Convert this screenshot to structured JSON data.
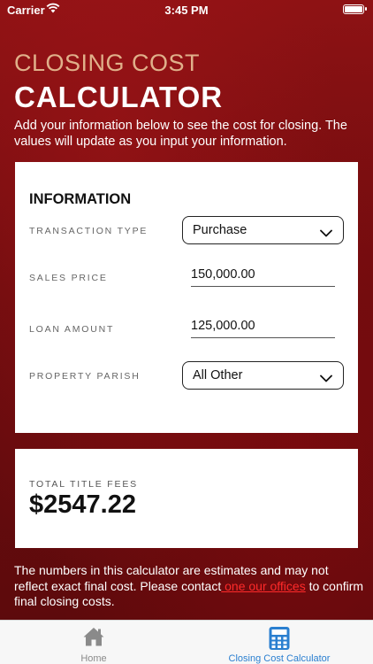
{
  "status_bar": {
    "carrier": "Carrier",
    "time": "3:45 PM",
    "battery_level": 1.0
  },
  "header": {
    "title_small": "CLOSING COST",
    "title_big": "CALCULATOR",
    "intro": "Add your information below to see the cost for closing. The values will update as you input your information."
  },
  "information": {
    "section_title": "INFORMATION",
    "transaction_type": {
      "label": "TRANSACTION TYPE",
      "value": "Purchase",
      "icon": "chevron-down-icon"
    },
    "sales_price": {
      "label": "SALES PRICE",
      "value": "150,000.00"
    },
    "loan_amount": {
      "label": "LOAN AMOUNT",
      "value": "125,000.00"
    },
    "property_parish": {
      "label": "PROPERTY PARISH",
      "value": "All Other",
      "icon": "chevron-down-icon"
    }
  },
  "totals": {
    "label": "TOTAL TITLE FEES",
    "value": "$2547.22"
  },
  "disclaimer": {
    "text_before": "The numbers in this calculator are estimates and may not reflect exact final cost. Please contact",
    "link_text": " one our offices",
    "text_after": " to confirm final closing costs."
  },
  "tabbar": {
    "items": [
      {
        "label": "Home",
        "icon": "home-icon",
        "active": false
      },
      {
        "label": "Closing Cost Calculator",
        "icon": "calculator-icon",
        "active": true
      }
    ]
  },
  "colors": {
    "background": "#7a0e10",
    "title_accent": "#e0b08a",
    "link": "#ff2a2a",
    "tab_active": "#2a7fd0",
    "tab_inactive": "#8a8a8a"
  }
}
